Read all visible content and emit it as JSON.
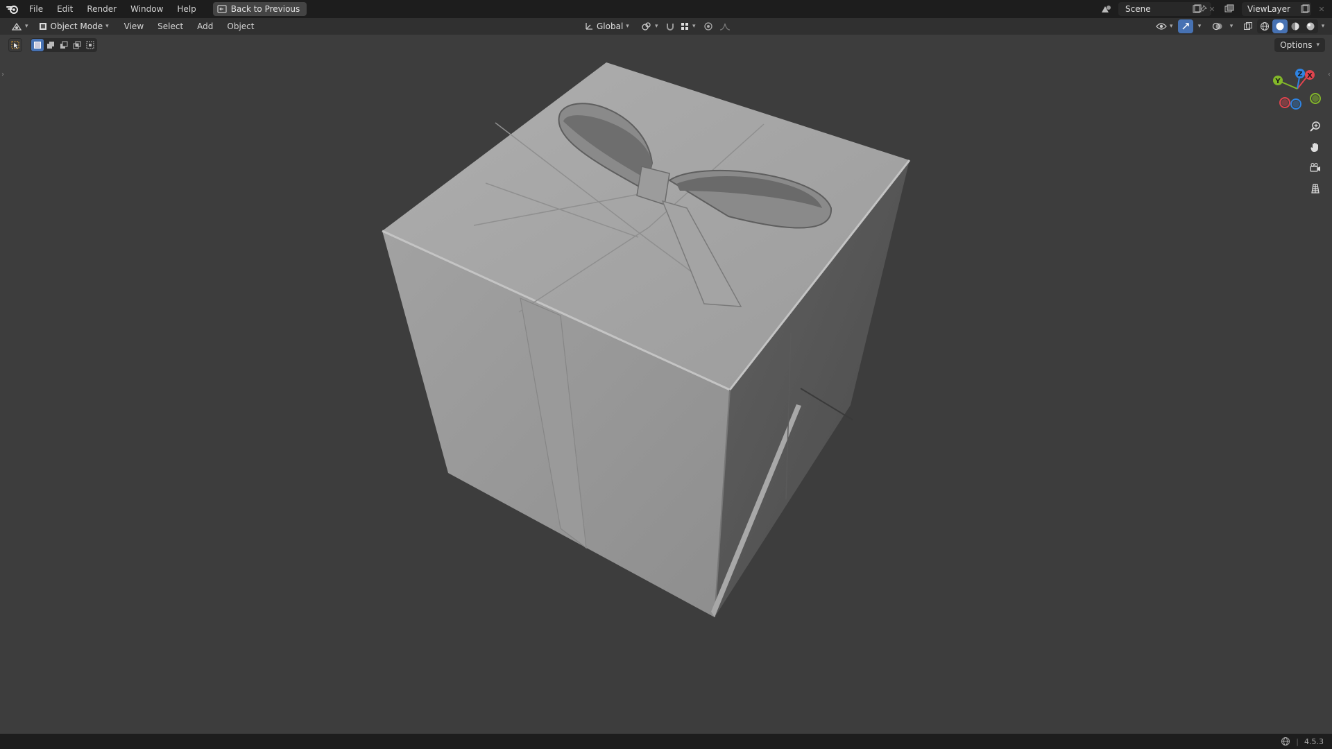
{
  "topbar": {
    "menus": [
      "File",
      "Edit",
      "Render",
      "Window",
      "Help"
    ],
    "back_button_label": "Back to Previous",
    "scene_name": "Scene",
    "view_layer_name": "ViewLayer"
  },
  "viewport_header": {
    "mode_label": "Object Mode",
    "menus": [
      "View",
      "Select",
      "Add",
      "Object"
    ],
    "transform_orientation": "Global",
    "options_label": "Options"
  },
  "gizmo": {
    "axis_y": "Y",
    "axis_z": "Z",
    "axis_x": "X"
  },
  "status_bar": {
    "version": "4.5.3"
  },
  "colors": {
    "viewport_bg": "#3d3d3d",
    "accent_blue": "#4772b3",
    "axis_x": "#e0444e",
    "axis_y": "#83b829",
    "axis_z": "#2f84e3"
  }
}
